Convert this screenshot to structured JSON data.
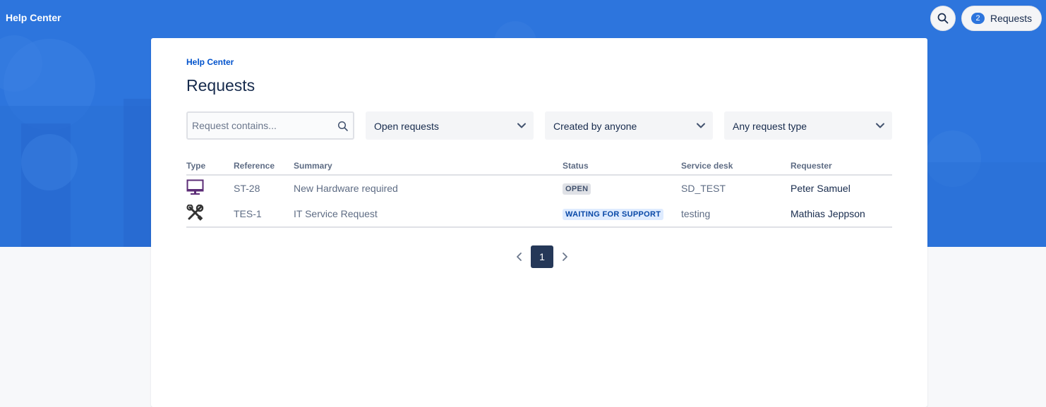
{
  "header": {
    "brand": "Help Center",
    "requests_count": "2",
    "requests_label": "Requests"
  },
  "main": {
    "breadcrumb": "Help Center",
    "title": "Requests",
    "search_placeholder": "Request contains...",
    "filters": {
      "status": "Open requests",
      "creator": "Created by anyone",
      "request_type": "Any request type"
    }
  },
  "table": {
    "columns": {
      "type": "Type",
      "reference": "Reference",
      "summary": "Summary",
      "status": "Status",
      "service_desk": "Service desk",
      "requester": "Requester"
    },
    "rows": [
      {
        "type_icon": "monitor-icon",
        "reference": "ST-28",
        "summary": "New Hardware required",
        "status": "OPEN",
        "service_desk": "SD_TEST",
        "requester": "Peter Samuel"
      },
      {
        "type_icon": "tools-icon",
        "reference": "TES-1",
        "summary": "IT Service Request",
        "status": "WAITING FOR SUPPORT",
        "service_desk": "testing",
        "requester": "Mathias Jeppson"
      }
    ]
  },
  "pagination": {
    "current_page": "1"
  },
  "colors": {
    "hero_blue": "#2d75dd",
    "lozenge_open_bg": "#dfe1e6",
    "lozenge_waiting_bg": "#deebff",
    "pager_active": "#253858"
  }
}
